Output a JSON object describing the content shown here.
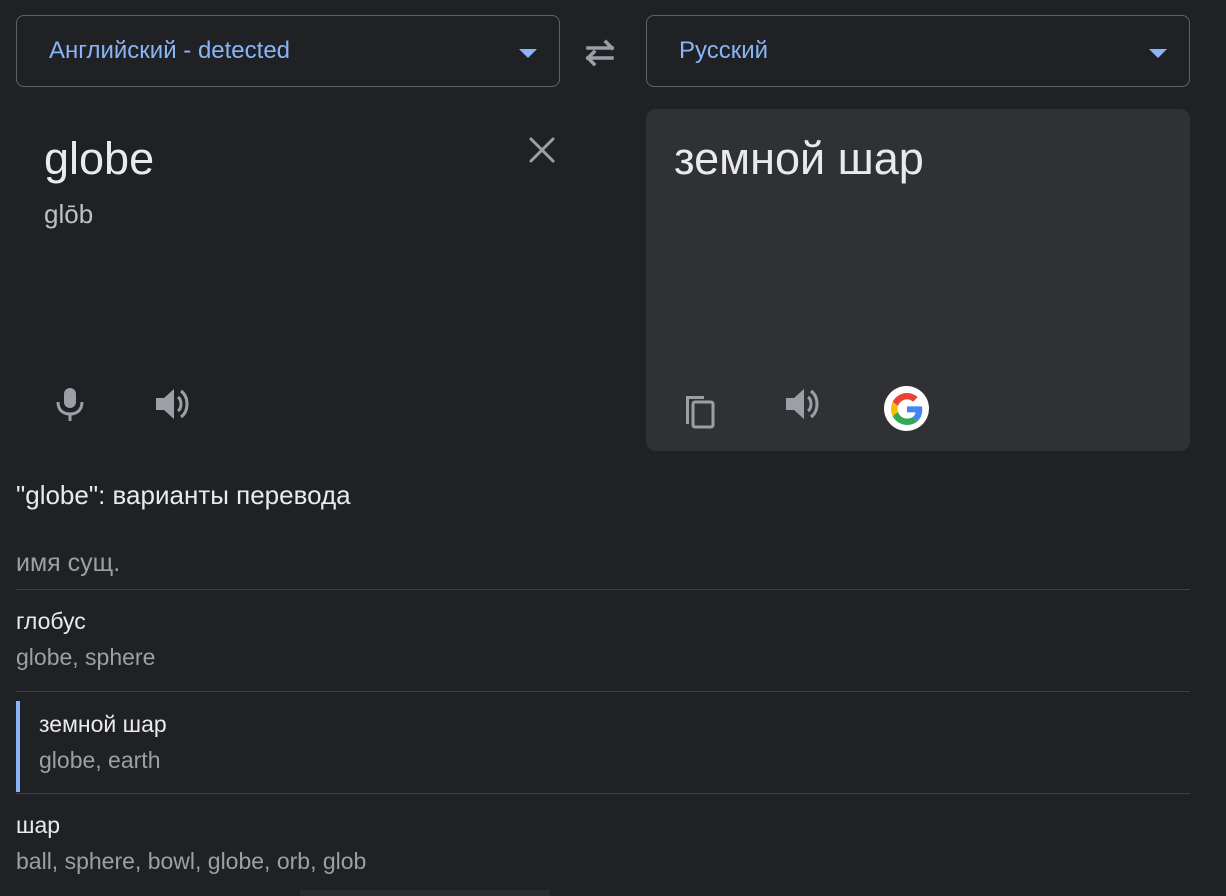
{
  "source_language": {
    "label": "Английский - detected"
  },
  "target_language": {
    "label": "Русский"
  },
  "source": {
    "text": "globe",
    "transliteration": "glōb"
  },
  "target": {
    "text": "земной шар"
  },
  "alternatives": {
    "title": "\"globe\": варианты перевода",
    "part_of_speech": "имя сущ.",
    "entries": [
      {
        "word": "глобус",
        "synonyms": "globe, sphere"
      },
      {
        "word": "земной шар",
        "synonyms": "globe, earth"
      },
      {
        "word": "шар",
        "synonyms": "ball, sphere, bowl, globe, orb, glob"
      }
    ]
  },
  "icons": {
    "swap": "swap-languages-icon",
    "clear": "close-icon",
    "mic": "microphone-icon",
    "listen_source": "speaker-icon",
    "copy": "copy-icon",
    "listen_target": "speaker-icon",
    "google": "google-logo-icon"
  },
  "colors": {
    "background": "#202124",
    "panel": "#303134",
    "accent": "#8ab4f8",
    "text": "#e8eaed",
    "muted": "#9aa0a6"
  }
}
